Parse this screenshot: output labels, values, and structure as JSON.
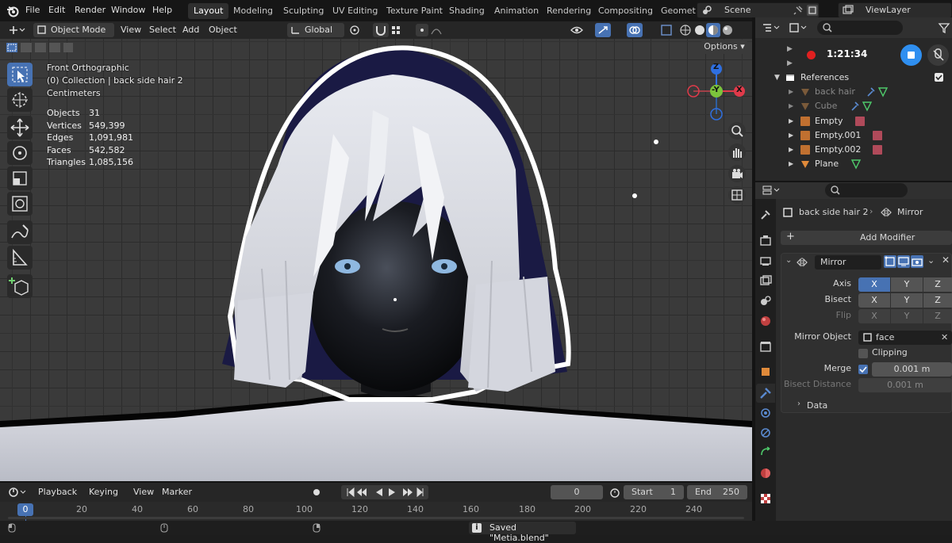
{
  "topbar": {
    "menus": [
      "File",
      "Edit",
      "Render",
      "Window",
      "Help"
    ],
    "workspaces": [
      "Layout",
      "Modeling",
      "Sculpting",
      "UV Editing",
      "Texture Paint",
      "Shading",
      "Animation",
      "Rendering",
      "Compositing",
      "Geomet"
    ],
    "active_workspace": "Layout",
    "scene": "Scene",
    "view_layer": "ViewLayer"
  },
  "viewport_header": {
    "mode": "Object Mode",
    "menus": [
      "View",
      "Select",
      "Add",
      "Object"
    ],
    "transform_orientation": "Global",
    "options": "Options"
  },
  "viewport": {
    "view_name": "Front Orthographic",
    "collection_line": "(0) Collection | back side hair 2",
    "units": "Centimeters",
    "stats": [
      {
        "label": "Objects",
        "value": "31"
      },
      {
        "label": "Vertices",
        "value": "549,399"
      },
      {
        "label": "Edges",
        "value": "1,091,981"
      },
      {
        "label": "Faces",
        "value": "542,582"
      },
      {
        "label": "Triangles",
        "value": "1,085,156"
      }
    ],
    "gizmo": {
      "z": "Z",
      "y": "-Y",
      "x": "X"
    }
  },
  "timeline": {
    "menus": [
      "Playback",
      "Keying",
      "View",
      "Marker"
    ],
    "current_frame": "0",
    "start_label": "Start",
    "start": "1",
    "end_label": "End",
    "end": "250",
    "ruler_ticks": [
      "0",
      "20",
      "40",
      "60",
      "80",
      "100",
      "120",
      "140",
      "160",
      "180",
      "200",
      "220",
      "240"
    ]
  },
  "statusbar": {
    "message": "Saved \"Metia.blend\""
  },
  "recording": {
    "time": "1:21:34"
  },
  "outliner": {
    "section": "References",
    "items": [
      {
        "name": "back hair",
        "dim": true
      },
      {
        "name": "Cube",
        "dim": true
      },
      {
        "name": "Empty",
        "dim": false
      },
      {
        "name": "Empty.001",
        "dim": false
      },
      {
        "name": "Empty.002",
        "dim": false
      },
      {
        "name": "Plane",
        "dim": false
      }
    ]
  },
  "properties": {
    "breadcrumb_object": "back side hair 2",
    "breadcrumb_modifier": "Mirror",
    "add_modifier": "Add Modifier",
    "modifier_name": "Mirror",
    "axis_label": "Axis",
    "bisect_label": "Bisect",
    "flip_label": "Flip",
    "axes": [
      "X",
      "Y",
      "Z"
    ],
    "mirror_object_label": "Mirror Object",
    "mirror_object": "face",
    "clipping_label": "Clipping",
    "merge_label": "Merge",
    "merge_value": "0.001 m",
    "bisect_distance_label": "Bisect Distance",
    "bisect_distance_value": "0.001 m",
    "data_label": "Data"
  },
  "colors": {
    "accent": "#4772b3",
    "record": "#e02020",
    "header_bg": "#303030"
  }
}
